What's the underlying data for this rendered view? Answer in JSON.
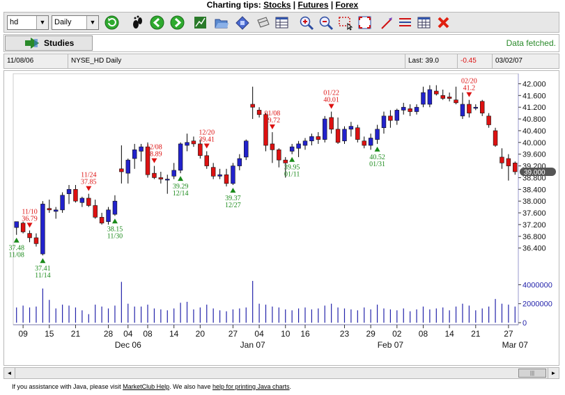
{
  "header": {
    "prefix": "Charting tips: ",
    "links": [
      "Stocks",
      "Futures",
      "Forex"
    ],
    "sep": "|"
  },
  "toolbar": {
    "symbol": "hd",
    "period": "Daily",
    "icons": [
      "refresh-icon",
      "footprint-icon",
      "back-icon",
      "forward-icon",
      "chart-icon",
      "open-icon",
      "save-icon",
      "print-icon",
      "table-icon",
      "zoom-in-icon",
      "zoom-out-icon",
      "select-zoom-icon",
      "fit-icon",
      "draw-line-icon",
      "lines-icon",
      "grid-icon",
      "close-icon"
    ]
  },
  "studies": {
    "label": "Studies",
    "status": "Data fetched."
  },
  "info": {
    "date": "11/08/06",
    "symbol": "NYSE_HD Daily",
    "last": "Last: 39.0",
    "change": "-0.45",
    "end_date": "03/02/07"
  },
  "footer": {
    "t1": "If you assistance with Java, please visit ",
    "l1": "MarketClub Help",
    "t2": ". We also have ",
    "l2": "help for printing Java charts",
    "t3": "."
  },
  "colors": {
    "up": "#2222cc",
    "down": "#dd1111",
    "volume": "#2222aa",
    "buy": "#1a8a1a",
    "sell": "#dd1111"
  },
  "chart_data": {
    "type": "candlestick",
    "price_ticks": [
      "42.000",
      "41.600",
      "41.200",
      "40.800",
      "40.400",
      "40.000",
      "39.600",
      "39.200",
      "38.800",
      "38.400",
      "38.000",
      "37.600",
      "37.200",
      "36.800",
      "36.400"
    ],
    "price_range": [
      35.8,
      42.2
    ],
    "last_price": "39.000",
    "volume_ticks": [
      "4000000",
      "2000000",
      "0"
    ],
    "volume_range": [
      0,
      4000000
    ],
    "x_ticks": [
      "09",
      "15",
      "21",
      "28",
      "04",
      "08",
      "14",
      "20",
      "27",
      "04",
      "10",
      "16",
      "23",
      "29",
      "02",
      "08",
      "14",
      "21",
      "27"
    ],
    "month_labels": [
      {
        "label": "Dec 06",
        "at": 4
      },
      {
        "label": "Jan 07",
        "at": 24
      },
      {
        "label": "Feb 07",
        "at": 43
      },
      {
        "label": "Mar 07",
        "at": 61
      }
    ],
    "candles": [
      {
        "date": "11/08",
        "o": 37.1,
        "h": 37.3,
        "l": 36.85,
        "c": 37.3,
        "v": 1600000
      },
      {
        "date": "11/09",
        "o": 37.25,
        "h": 37.3,
        "l": 36.9,
        "c": 36.95,
        "v": 1800000
      },
      {
        "date": "11/10",
        "o": 36.9,
        "h": 37.0,
        "l": 36.6,
        "c": 36.75,
        "v": 1600000
      },
      {
        "date": "11/13",
        "o": 36.75,
        "h": 36.9,
        "l": 36.45,
        "c": 36.55,
        "v": 1700000
      },
      {
        "date": "11/14",
        "o": 36.2,
        "h": 38.0,
        "l": 36.15,
        "c": 37.9,
        "v": 3600000
      },
      {
        "date": "11/15",
        "o": 37.75,
        "h": 38.05,
        "l": 37.6,
        "c": 37.7,
        "v": 2400000
      },
      {
        "date": "11/16",
        "o": 37.65,
        "h": 37.8,
        "l": 37.4,
        "c": 37.7,
        "v": 1500000
      },
      {
        "date": "11/17",
        "o": 37.7,
        "h": 38.3,
        "l": 37.6,
        "c": 38.2,
        "v": 1900000
      },
      {
        "date": "11/20",
        "o": 38.25,
        "h": 38.55,
        "l": 37.9,
        "c": 38.4,
        "v": 1800000
      },
      {
        "date": "11/21",
        "o": 38.4,
        "h": 38.55,
        "l": 37.95,
        "c": 38.0,
        "v": 1600000
      },
      {
        "date": "11/22",
        "o": 37.95,
        "h": 38.15,
        "l": 37.8,
        "c": 38.1,
        "v": 1300000
      },
      {
        "date": "11/24",
        "o": 38.1,
        "h": 38.25,
        "l": 37.8,
        "c": 37.85,
        "v": 900000
      },
      {
        "date": "11/27",
        "o": 37.85,
        "h": 38.05,
        "l": 37.4,
        "c": 37.45,
        "v": 1900000
      },
      {
        "date": "11/28",
        "o": 37.45,
        "h": 37.6,
        "l": 37.2,
        "c": 37.25,
        "v": 1700000
      },
      {
        "date": "11/29",
        "o": 37.3,
        "h": 37.8,
        "l": 37.2,
        "c": 37.7,
        "v": 1500000
      },
      {
        "date": "11/30",
        "o": 37.55,
        "h": 38.2,
        "l": 37.5,
        "c": 38.0,
        "v": 1800000
      },
      {
        "date": "12/01",
        "o": 39.1,
        "h": 39.9,
        "l": 38.6,
        "c": 39.0,
        "v": 4300000
      },
      {
        "date": "12/04",
        "o": 38.95,
        "h": 39.45,
        "l": 38.6,
        "c": 39.4,
        "v": 2000000
      },
      {
        "date": "12/05",
        "o": 39.45,
        "h": 39.95,
        "l": 39.1,
        "c": 39.75,
        "v": 1700000
      },
      {
        "date": "12/06",
        "o": 39.7,
        "h": 39.95,
        "l": 39.35,
        "c": 39.85,
        "v": 1700000
      },
      {
        "date": "12/07",
        "o": 39.85,
        "h": 40.0,
        "l": 38.8,
        "c": 38.9,
        "v": 1900000
      },
      {
        "date": "12/08",
        "o": 38.95,
        "h": 39.2,
        "l": 38.75,
        "c": 38.8,
        "v": 1500000
      },
      {
        "date": "12/11",
        "o": 38.8,
        "h": 39.0,
        "l": 38.6,
        "c": 38.75,
        "v": 1400000
      },
      {
        "date": "12/12",
        "o": 38.75,
        "h": 38.9,
        "l": 38.25,
        "c": 38.75,
        "v": 1300000
      },
      {
        "date": "12/13",
        "o": 38.85,
        "h": 39.3,
        "l": 38.75,
        "c": 39.05,
        "v": 1500000
      },
      {
        "date": "12/14",
        "o": 39.05,
        "h": 40.0,
        "l": 38.95,
        "c": 39.95,
        "v": 2100000
      },
      {
        "date": "12/15",
        "o": 39.9,
        "h": 40.3,
        "l": 39.7,
        "c": 40.0,
        "v": 2200000
      },
      {
        "date": "12/18",
        "o": 40.05,
        "h": 40.2,
        "l": 39.85,
        "c": 39.95,
        "v": 1400000
      },
      {
        "date": "12/19",
        "o": 39.95,
        "h": 40.1,
        "l": 39.45,
        "c": 39.55,
        "v": 1600000
      },
      {
        "date": "12/20",
        "o": 39.55,
        "h": 39.7,
        "l": 39.1,
        "c": 39.2,
        "v": 1900000
      },
      {
        "date": "12/21",
        "o": 39.15,
        "h": 39.3,
        "l": 38.75,
        "c": 38.85,
        "v": 1500000
      },
      {
        "date": "12/22",
        "o": 38.85,
        "h": 39.1,
        "l": 38.75,
        "c": 38.9,
        "v": 1300000
      },
      {
        "date": "12/26",
        "o": 38.9,
        "h": 39.1,
        "l": 38.5,
        "c": 38.6,
        "v": 1200000
      },
      {
        "date": "12/27",
        "o": 38.6,
        "h": 39.3,
        "l": 38.55,
        "c": 39.2,
        "v": 1400000
      },
      {
        "date": "12/28",
        "o": 39.2,
        "h": 39.6,
        "l": 39.05,
        "c": 39.45,
        "v": 1500000
      },
      {
        "date": "12/29",
        "o": 39.5,
        "h": 40.1,
        "l": 39.4,
        "c": 40.05,
        "v": 1600000
      },
      {
        "date": "01/03",
        "o": 41.3,
        "h": 41.9,
        "l": 40.8,
        "c": 41.2,
        "v": 4400000
      },
      {
        "date": "01/04",
        "o": 41.1,
        "h": 41.2,
        "l": 40.85,
        "c": 40.95,
        "v": 2000000
      },
      {
        "date": "01/05",
        "o": 40.95,
        "h": 41.0,
        "l": 39.7,
        "c": 39.9,
        "v": 1900000
      },
      {
        "date": "01/08",
        "o": 39.95,
        "h": 40.35,
        "l": 39.3,
        "c": 39.75,
        "v": 1700000
      },
      {
        "date": "01/09",
        "o": 39.75,
        "h": 39.8,
        "l": 39.15,
        "c": 39.4,
        "v": 1600000
      },
      {
        "date": "01/10",
        "o": 39.4,
        "h": 39.5,
        "l": 38.8,
        "c": 39.3,
        "v": 1400000
      },
      {
        "date": "01/11",
        "o": 39.7,
        "h": 39.95,
        "l": 39.6,
        "c": 39.85,
        "v": 1300000
      },
      {
        "date": "01/12",
        "o": 39.8,
        "h": 40.05,
        "l": 39.5,
        "c": 39.95,
        "v": 1500000
      },
      {
        "date": "01/16",
        "o": 39.9,
        "h": 40.15,
        "l": 39.75,
        "c": 40.05,
        "v": 1600000
      },
      {
        "date": "01/17",
        "o": 40.05,
        "h": 40.3,
        "l": 39.9,
        "c": 40.2,
        "v": 1400000
      },
      {
        "date": "01/18",
        "o": 40.2,
        "h": 40.35,
        "l": 39.95,
        "c": 40.1,
        "v": 1500000
      },
      {
        "date": "01/19",
        "o": 40.1,
        "h": 40.9,
        "l": 40.0,
        "c": 40.8,
        "v": 1800000
      },
      {
        "date": "01/22",
        "o": 40.85,
        "h": 41.05,
        "l": 40.3,
        "c": 40.45,
        "v": 2000000
      },
      {
        "date": "01/23",
        "o": 40.45,
        "h": 40.85,
        "l": 39.95,
        "c": 40.0,
        "v": 1600000
      },
      {
        "date": "01/24",
        "o": 40.05,
        "h": 40.55,
        "l": 39.95,
        "c": 40.45,
        "v": 1500000
      },
      {
        "date": "01/25",
        "o": 40.45,
        "h": 40.7,
        "l": 40.2,
        "c": 40.55,
        "v": 1400000
      },
      {
        "date": "01/26",
        "o": 40.5,
        "h": 40.6,
        "l": 40.0,
        "c": 40.1,
        "v": 1300000
      },
      {
        "date": "01/29",
        "o": 40.05,
        "h": 40.2,
        "l": 39.8,
        "c": 39.9,
        "v": 1600000
      },
      {
        "date": "01/30",
        "o": 39.9,
        "h": 40.3,
        "l": 39.75,
        "c": 40.15,
        "v": 1400000
      },
      {
        "date": "01/31",
        "o": 40.1,
        "h": 40.6,
        "l": 39.95,
        "c": 40.45,
        "v": 1900000
      },
      {
        "date": "02/01",
        "o": 40.5,
        "h": 41.05,
        "l": 40.3,
        "c": 40.9,
        "v": 1500000
      },
      {
        "date": "02/02",
        "o": 40.9,
        "h": 41.1,
        "l": 40.5,
        "c": 40.75,
        "v": 1400000
      },
      {
        "date": "02/05",
        "o": 40.75,
        "h": 41.15,
        "l": 40.6,
        "c": 41.1,
        "v": 1300000
      },
      {
        "date": "02/06",
        "o": 41.1,
        "h": 41.35,
        "l": 40.95,
        "c": 41.2,
        "v": 1500000
      },
      {
        "date": "02/07",
        "o": 41.15,
        "h": 41.3,
        "l": 40.9,
        "c": 41.05,
        "v": 1200000
      },
      {
        "date": "02/08",
        "o": 41.05,
        "h": 41.3,
        "l": 40.95,
        "c": 41.2,
        "v": 1400000
      },
      {
        "date": "02/09",
        "o": 41.3,
        "h": 41.9,
        "l": 41.2,
        "c": 41.7,
        "v": 1700000
      },
      {
        "date": "02/12",
        "o": 41.3,
        "h": 41.95,
        "l": 41.2,
        "c": 41.8,
        "v": 1400000
      },
      {
        "date": "02/13",
        "o": 41.75,
        "h": 41.95,
        "l": 41.6,
        "c": 41.65,
        "v": 1500000
      },
      {
        "date": "02/14",
        "o": 41.6,
        "h": 41.8,
        "l": 41.45,
        "c": 41.5,
        "v": 1600000
      },
      {
        "date": "02/15",
        "o": 41.55,
        "h": 41.7,
        "l": 41.4,
        "c": 41.5,
        "v": 1300000
      },
      {
        "date": "02/16",
        "o": 41.45,
        "h": 41.9,
        "l": 41.3,
        "c": 41.35,
        "v": 1700000
      },
      {
        "date": "02/20",
        "o": 40.9,
        "h": 41.7,
        "l": 40.8,
        "c": 41.3,
        "v": 2000000
      },
      {
        "date": "02/21",
        "o": 41.3,
        "h": 41.45,
        "l": 40.85,
        "c": 41.0,
        "v": 1800000
      },
      {
        "date": "02/22",
        "o": 41.2,
        "h": 41.3,
        "l": 41.1,
        "c": 41.2,
        "v": 1300000
      },
      {
        "date": "02/23",
        "o": 41.4,
        "h": 41.45,
        "l": 40.9,
        "c": 41.0,
        "v": 1500000
      },
      {
        "date": "02/26",
        "o": 40.9,
        "h": 41.0,
        "l": 40.5,
        "c": 40.6,
        "v": 1700000
      },
      {
        "date": "02/27",
        "o": 40.4,
        "h": 40.5,
        "l": 39.85,
        "c": 39.9,
        "v": 2500000
      },
      {
        "date": "02/28",
        "o": 39.5,
        "h": 39.8,
        "l": 39.1,
        "c": 39.3,
        "v": 2000000
      },
      {
        "date": "03/01",
        "o": 39.45,
        "h": 39.6,
        "l": 38.7,
        "c": 39.2,
        "v": 1900000
      },
      {
        "date": "03/02",
        "o": 39.3,
        "h": 39.35,
        "l": 38.9,
        "c": 39.0,
        "v": 1700000
      }
    ],
    "signals": [
      {
        "idx": 0,
        "type": "buy",
        "price": "37.48",
        "date": "11/08"
      },
      {
        "idx": 2,
        "type": "sell",
        "price": "36.79",
        "date": "11/10"
      },
      {
        "idx": 4,
        "type": "buy",
        "price": "37.41",
        "date": "11/14"
      },
      {
        "idx": 11,
        "type": "sell",
        "price": "37.85",
        "date": "11/24"
      },
      {
        "idx": 15,
        "type": "buy",
        "price": "38.15",
        "date": "11/30"
      },
      {
        "idx": 21,
        "type": "sell",
        "price": "38.89",
        "date": "12/08"
      },
      {
        "idx": 25,
        "type": "buy",
        "price": "39.29",
        "date": "12/14"
      },
      {
        "idx": 29,
        "type": "sell",
        "price": "39.41",
        "date": "12/20"
      },
      {
        "idx": 33,
        "type": "buy",
        "price": "39.37",
        "date": "12/27"
      },
      {
        "idx": 39,
        "type": "sell",
        "price": "39.72",
        "date": "01/08"
      },
      {
        "idx": 42,
        "type": "buy",
        "price": "39.95",
        "date": "01/11"
      },
      {
        "idx": 48,
        "type": "sell",
        "price": "40.01",
        "date": "01/22"
      },
      {
        "idx": 55,
        "type": "buy",
        "price": "40.52",
        "date": "01/31"
      },
      {
        "idx": 69,
        "type": "sell",
        "price": "41.2",
        "date": "02/20"
      }
    ]
  }
}
